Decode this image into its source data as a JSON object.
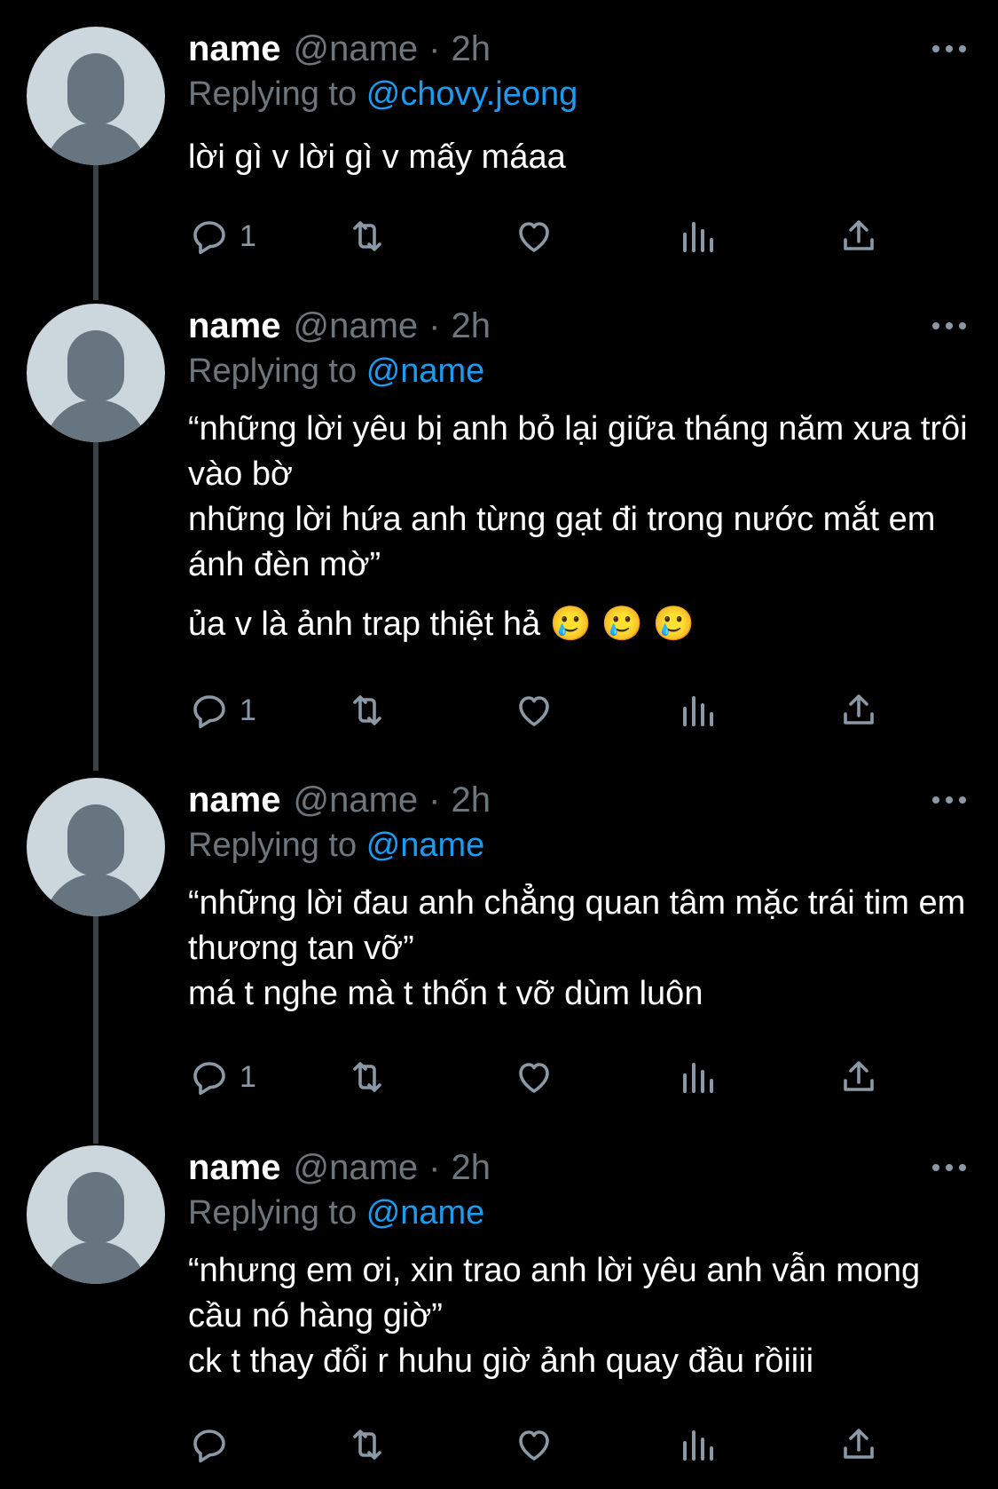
{
  "colors": {
    "background": "#000000",
    "link": "#1d9bf0",
    "muted": "#6e767d",
    "text": "#ffffff"
  },
  "icons": [
    "more-icon",
    "reply-icon",
    "retweet-icon",
    "like-icon",
    "analytics-icon",
    "share-icon"
  ],
  "tweets": [
    {
      "display_name": "name",
      "handle": "@name",
      "dot": "·",
      "time": "2h",
      "replying_prefix": "Replying to",
      "replying_to": "@chovy.jeong",
      "body": "lời gì v lời gì v mấy máaa",
      "reply_count": "1"
    },
    {
      "display_name": "name",
      "handle": "@name",
      "dot": "·",
      "time": "2h",
      "replying_prefix": "Replying to",
      "replying_to": "@name",
      "body": "“những lời yêu bị anh bỏ lại giữa tháng năm xưa trôi vào bờ\nnhững lời hứa anh từng gạt đi trong nước mắt em ánh đèn mờ”",
      "body2": "ủa v là ảnh trap thiệt hả 🥲 🥲 🥲",
      "reply_count": "1"
    },
    {
      "display_name": "name",
      "handle": "@name",
      "dot": "·",
      "time": "2h",
      "replying_prefix": "Replying to",
      "replying_to": "@name",
      "body": "“những lời đau anh chẳng quan tâm mặc trái tim em thương tan vỡ”\nmá t nghe mà t thốn t vỡ dùm luôn",
      "reply_count": "1"
    },
    {
      "display_name": "name",
      "handle": "@name",
      "dot": "·",
      "time": "2h",
      "replying_prefix": "Replying to",
      "replying_to": "@name",
      "body": "“nhưng em ơi, xin trao anh lời yêu anh vẫn mong cầu nó hàng giờ”\nck t thay đổi r huhu giờ ảnh quay đầu rồiiii",
      "reply_count": ""
    }
  ]
}
